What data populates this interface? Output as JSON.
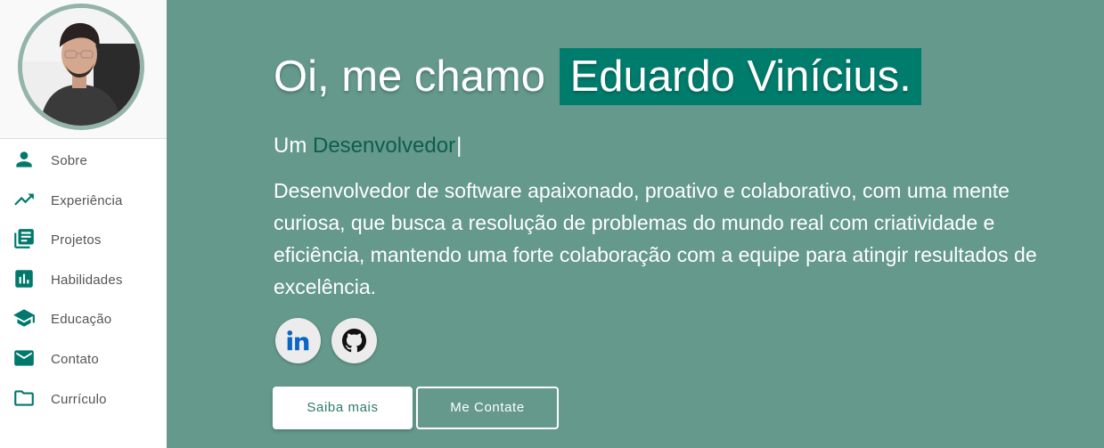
{
  "sidebar": {
    "profile_photo": "profile-photo",
    "items": [
      {
        "label": "Sobre",
        "icon": "person-icon"
      },
      {
        "label": "Experiência",
        "icon": "trending-up-icon"
      },
      {
        "label": "Projetos",
        "icon": "library-books-icon"
      },
      {
        "label": "Habilidades",
        "icon": "bar-chart-icon"
      },
      {
        "label": "Educação",
        "icon": "school-icon"
      },
      {
        "label": "Contato",
        "icon": "mail-icon"
      },
      {
        "label": "Currículo",
        "icon": "folder-icon"
      }
    ]
  },
  "hero": {
    "greeting": "Oi, me chamo",
    "name": "Eduardo Vinícius.",
    "role_prefix": "Um",
    "role_typed": "Desenvolvedor",
    "caret": "|",
    "bio": "Desenvolvedor de software apaixonado, proativo e colaborativo, com uma mente curiosa, que busca a resolução de problemas do mundo real com criatividade e eficiência, mantendo uma forte colaboração com a equipe para atingir resultados de excelência."
  },
  "socials": [
    {
      "icon": "linkedin-icon"
    },
    {
      "icon": "github-icon"
    }
  ],
  "buttons": {
    "primary": "Saiba mais",
    "secondary": "Me Contate"
  },
  "colors": {
    "accent": "#007c6c",
    "hero_background": "#64998c",
    "icon": "#00796b",
    "typed_text": "#0e5d4f"
  }
}
